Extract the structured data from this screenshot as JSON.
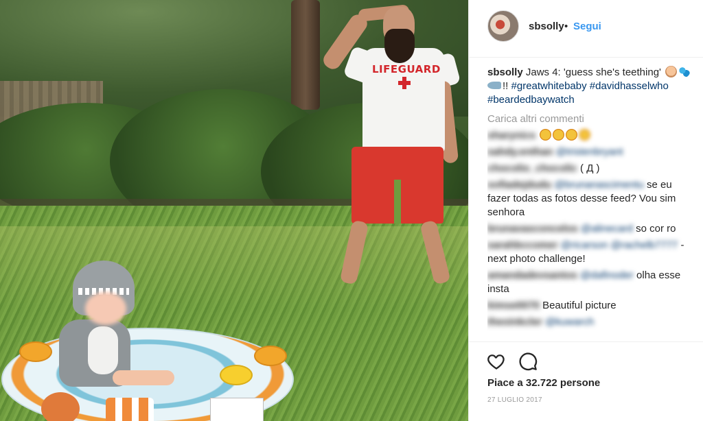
{
  "post": {
    "username": "sbsolly",
    "separator": "•",
    "follow_label": "Segui"
  },
  "caption": {
    "username": "sbsolly",
    "text": "Jaws 4: 'guess she's teething'",
    "text2": "!!",
    "hashtags": [
      "#greatwhitebaby",
      "#davidhasselwho",
      "#beardedbaywatch"
    ]
  },
  "load_more_label": "Carica altri commenti",
  "comments": [
    {
      "user": "sharynics",
      "mention": "",
      "text": ""
    },
    {
      "user": "sahdy.enthan",
      "mention": "@tristenbryant",
      "text": ""
    },
    {
      "user": "chocolio_chocolic",
      "mention": "",
      "text": "( Д )"
    },
    {
      "user": "sofiadejdudu",
      "mention": "@brunanascimentu",
      "text": "se eu fazer todas as fotos desse feed? Vou sim senhora"
    },
    {
      "user": "brunavasconcelos",
      "mention": "@alinecard",
      "text": "so cor ro"
    },
    {
      "user": "sarahbccomer",
      "mention": "@ricarson @rachelb7777",
      "text": "- next photo challenge!"
    },
    {
      "user": "amandadevsantos",
      "mention": "@dafinoder",
      "text": "olha esse insta"
    },
    {
      "user": "kimse0070",
      "mention": "",
      "text": "Beautiful picture"
    },
    {
      "user": "theoinkcler",
      "mention": "@kuwarch",
      "text": ""
    }
  ],
  "likes_text": "Piace a 32.722 persone",
  "date": "27 LUGLIO 2017",
  "icons": {
    "like": "heart-icon",
    "comment": "comment-bubble-icon"
  },
  "colors": {
    "link": "#3897f0",
    "hashtag": "#003569",
    "muted": "#999999"
  }
}
